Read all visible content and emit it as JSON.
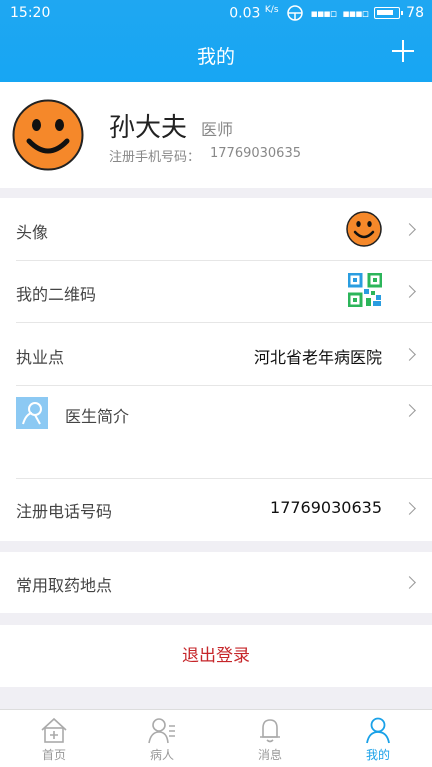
{
  "status_bar": {
    "time": "15:20",
    "speed": "0.03",
    "speed_unit": "K/s",
    "battery": "78"
  },
  "header": {
    "title": "我的",
    "add_icon": "plus-icon"
  },
  "profile": {
    "name": "孙大夫",
    "role": "医师",
    "phone_label": "注册手机号码：",
    "phone": "17769030635",
    "avatar_icon": "smiley-avatar"
  },
  "rows": {
    "avatar": {
      "label": "头像"
    },
    "qrcode": {
      "label": "我的二维码"
    },
    "practice": {
      "label": "执业点",
      "value": "河北省老年病医院"
    },
    "intro": {
      "label": "医生简介"
    },
    "reg_phone": {
      "label": "注册电话号码",
      "value": "17769030635"
    },
    "pickup": {
      "label": "常用取药地点"
    }
  },
  "logout_label": "退出登录",
  "tabs": [
    {
      "label": "首页",
      "icon": "home-icon",
      "active": false
    },
    {
      "label": "病人",
      "icon": "patients-icon",
      "active": false
    },
    {
      "label": "消息",
      "icon": "bell-icon",
      "active": false
    },
    {
      "label": "我的",
      "icon": "user-icon",
      "active": true
    }
  ],
  "colors": {
    "accent": "#17a6f3",
    "logout": "#c6262a",
    "avatar": "#f5882a"
  }
}
